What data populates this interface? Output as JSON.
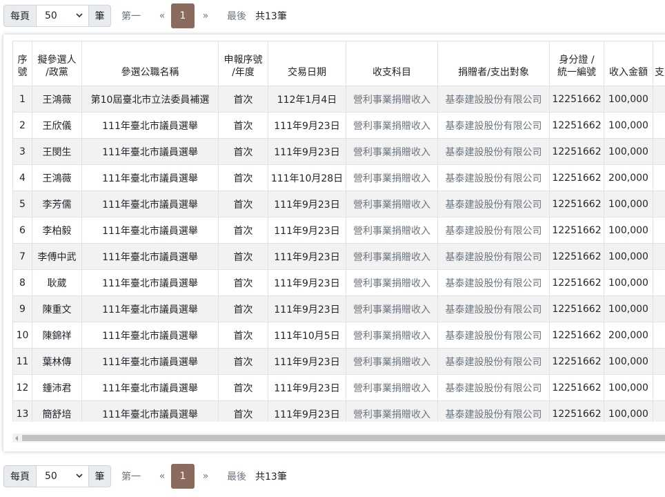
{
  "pager": {
    "per_page_label": "每頁",
    "per_page_value": "50",
    "unit_label": "筆",
    "first_label": "第一",
    "prev_label": "«",
    "current_page": "1",
    "next_label": "»",
    "last_label": "最後",
    "total_label": "共13筆"
  },
  "table": {
    "headers": {
      "seq_1": "序",
      "seq_2": "號",
      "candidate_1": "擬參選人",
      "candidate_2": "/政黨",
      "election": "參選公職名稱",
      "report_1": "申報序號",
      "report_2": "/年度",
      "date": "交易日期",
      "category": "收支科目",
      "donor": "捐贈者/支出對象",
      "id_1": "身分證 /",
      "id_2": "統一編號",
      "income": "收入金額",
      "more": "支"
    },
    "rows": [
      {
        "seq": "1",
        "candidate": "王鴻薇",
        "election": "第10屆臺北市立法委員補選",
        "report": "首次",
        "date": "112年1月4日",
        "category": "營利事業捐贈收入",
        "donor": "基泰建設股份有限公司",
        "id": "12251662",
        "income": "100,000"
      },
      {
        "seq": "2",
        "candidate": "王欣儀",
        "election": "111年臺北市議員選舉",
        "report": "首次",
        "date": "111年9月23日",
        "category": "營利事業捐贈收入",
        "donor": "基泰建設股份有限公司",
        "id": "12251662",
        "income": "100,000"
      },
      {
        "seq": "3",
        "candidate": "王閔生",
        "election": "111年臺北市議員選舉",
        "report": "首次",
        "date": "111年9月23日",
        "category": "營利事業捐贈收入",
        "donor": "基泰建設股份有限公司",
        "id": "12251662",
        "income": "100,000"
      },
      {
        "seq": "4",
        "candidate": "王鴻薇",
        "election": "111年臺北市議員選舉",
        "report": "首次",
        "date": "111年10月28日",
        "category": "營利事業捐贈收入",
        "donor": "基泰建設股份有限公司",
        "id": "12251662",
        "income": "200,000"
      },
      {
        "seq": "5",
        "candidate": "李芳儒",
        "election": "111年臺北市議員選舉",
        "report": "首次",
        "date": "111年9月23日",
        "category": "營利事業捐贈收入",
        "donor": "基泰建設股份有限公司",
        "id": "12251662",
        "income": "100,000"
      },
      {
        "seq": "6",
        "candidate": "李柏毅",
        "election": "111年臺北市議員選舉",
        "report": "首次",
        "date": "111年9月23日",
        "category": "營利事業捐贈收入",
        "donor": "基泰建設股份有限公司",
        "id": "12251662",
        "income": "100,000"
      },
      {
        "seq": "7",
        "candidate": "李傅中武",
        "election": "111年臺北市議員選舉",
        "report": "首次",
        "date": "111年9月23日",
        "category": "營利事業捐贈收入",
        "donor": "基泰建設股份有限公司",
        "id": "12251662",
        "income": "100,000"
      },
      {
        "seq": "8",
        "candidate": "耿葳",
        "election": "111年臺北市議員選舉",
        "report": "首次",
        "date": "111年9月23日",
        "category": "營利事業捐贈收入",
        "donor": "基泰建設股份有限公司",
        "id": "12251662",
        "income": "100,000"
      },
      {
        "seq": "9",
        "candidate": "陳重文",
        "election": "111年臺北市議員選舉",
        "report": "首次",
        "date": "111年9月23日",
        "category": "營利事業捐贈收入",
        "donor": "基泰建設股份有限公司",
        "id": "12251662",
        "income": "100,000"
      },
      {
        "seq": "10",
        "candidate": "陳錦祥",
        "election": "111年臺北市議員選舉",
        "report": "首次",
        "date": "111年10月5日",
        "category": "營利事業捐贈收入",
        "donor": "基泰建設股份有限公司",
        "id": "12251662",
        "income": "200,000"
      },
      {
        "seq": "11",
        "candidate": "葉林傳",
        "election": "111年臺北市議員選舉",
        "report": "首次",
        "date": "111年9月23日",
        "category": "營利事業捐贈收入",
        "donor": "基泰建設股份有限公司",
        "id": "12251662",
        "income": "100,000"
      },
      {
        "seq": "12",
        "candidate": "鍾沛君",
        "election": "111年臺北市議員選舉",
        "report": "首次",
        "date": "111年9月23日",
        "category": "營利事業捐贈收入",
        "donor": "基泰建設股份有限公司",
        "id": "12251662",
        "income": "100,000"
      },
      {
        "seq": "13",
        "candidate": "簡舒培",
        "election": "111年臺北市議員選舉",
        "report": "首次",
        "date": "111年9月23日",
        "category": "營利事業捐贈收入",
        "donor": "基泰建設股份有限公司",
        "id": "12251662",
        "income": "100,000"
      }
    ]
  },
  "colors": {
    "active_page_bg": "#8b6b5e",
    "stripe_bg": "#f2f2f2",
    "muted_text": "#6c757d"
  }
}
